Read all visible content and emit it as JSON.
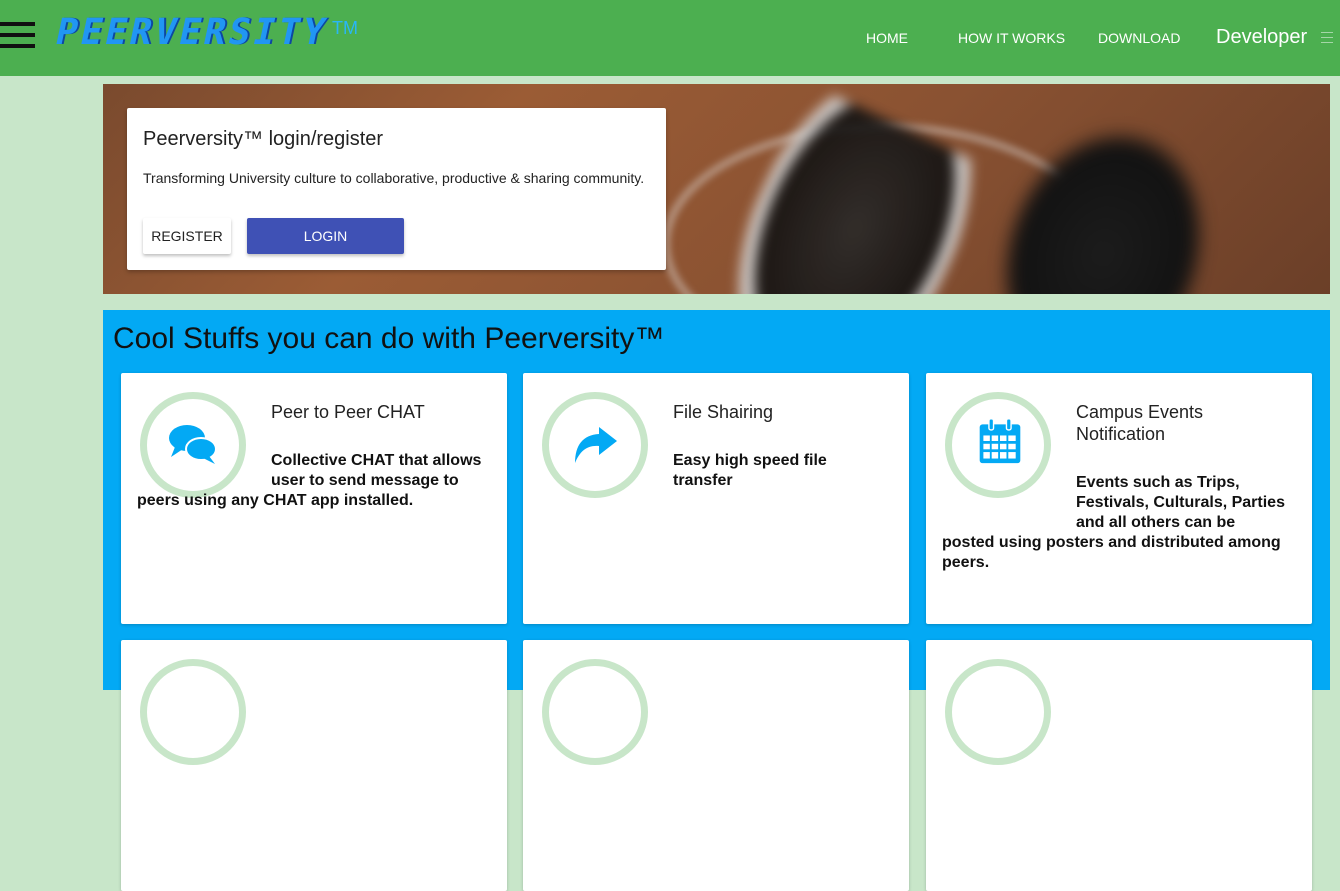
{
  "header": {
    "logo_text": "PEERVERSITY",
    "logo_tm": "TM",
    "nav": [
      {
        "label": "HOME"
      },
      {
        "label": "HOW IT WORKS"
      },
      {
        "label": "DOWNLOAD"
      }
    ],
    "developer_label": "Developer"
  },
  "login": {
    "title": "Peerversity™ login/register",
    "subtitle": "Transforming University culture to collaborative, productive & sharing community.",
    "register_label": "REGISTER",
    "login_label": "LOGIN"
  },
  "features": {
    "title": "Cool Stuffs you can do with Peerversity™",
    "cards": [
      {
        "heading": "Peer to Peer CHAT",
        "body": "Collective CHAT that allows user to send message to peers using any CHAT app installed.",
        "icon": "chat-icon"
      },
      {
        "heading": "File Shairing",
        "body": "Easy high speed file transfer",
        "icon": "share-icon"
      },
      {
        "heading": "Campus Events Notification",
        "body": "Events such as Trips, Festivals, Culturals, Parties and all others can be posted using posters and distributed among peers.",
        "icon": "calendar-icon"
      }
    ]
  },
  "colors": {
    "header_bg": "#4caf50",
    "page_bg": "#c8e6c9",
    "features_bg": "#03a9f4",
    "login_button": "#3f51b5",
    "icon_blue": "#03a9f4"
  }
}
